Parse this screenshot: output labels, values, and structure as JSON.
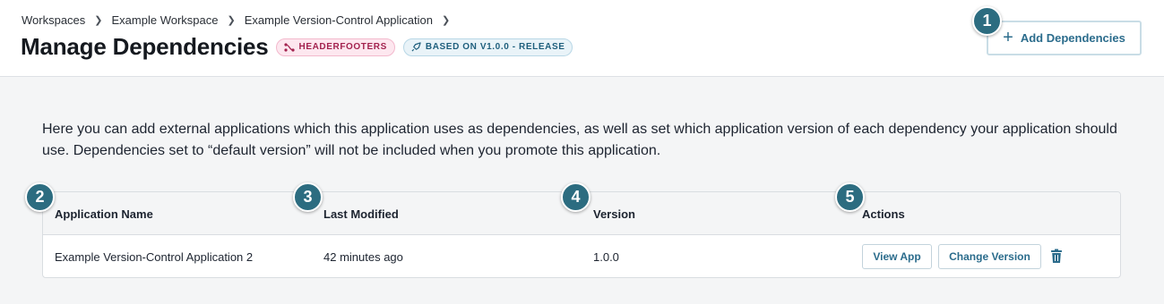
{
  "breadcrumb": {
    "items": [
      "Workspaces",
      "Example Workspace",
      "Example Version-Control Application"
    ]
  },
  "page": {
    "title": "Manage Dependencies",
    "branch_badge": "HEADERFOOTERS",
    "release_badge": "BASED ON V1.0.0 - RELEASE"
  },
  "toolbar": {
    "add_label": "Add Dependencies"
  },
  "intro": {
    "text": "Here you can add external applications which this application uses as dependencies, as well as set which application version of each dependency your application should use. Dependencies set to “default version” will not be included when you promote this application."
  },
  "table": {
    "columns": [
      "Application Name",
      "Last Modified",
      "Version",
      "Actions"
    ],
    "rows": [
      {
        "name": "Example Version-Control Application 2",
        "modified": "42 minutes ago",
        "version": "1.0.0",
        "view_label": "View App",
        "change_label": "Change Version",
        "delete_icon": "trash-icon"
      }
    ]
  },
  "callouts": [
    "1",
    "2",
    "3",
    "4",
    "5"
  ],
  "colors": {
    "accent": "#2b6c8c",
    "callout": "#2c6c80",
    "branch_badge_text": "#a3234f",
    "branch_badge_bg": "#fde7ef",
    "release_badge_bg": "#e9f3f8"
  }
}
